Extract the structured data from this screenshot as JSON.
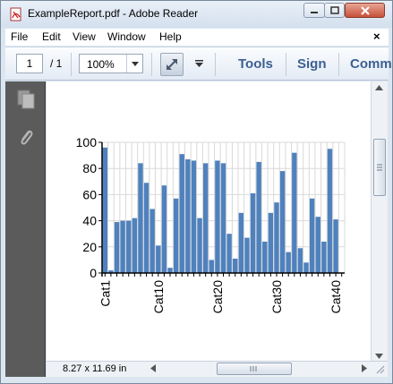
{
  "window": {
    "title": "ExampleReport.pdf - Adobe Reader"
  },
  "menu": {
    "items": [
      "File",
      "Edit",
      "View",
      "Window",
      "Help"
    ],
    "close_label": "×"
  },
  "toolbar": {
    "page_current": "1",
    "page_total": "/ 1",
    "zoom": "100%",
    "tools_label": "Tools",
    "sign_label": "Sign",
    "comment_label": "Comm"
  },
  "status": {
    "page_size": "8.27 x 11.69 in"
  },
  "colors": {
    "bar": "#4f81bd",
    "accent_link": "#3c5f91",
    "nav_pane": "#5b5b5b"
  },
  "icons": {
    "title": "pdf-file-icon",
    "nav_pages": "pages-icon",
    "nav_attach": "paperclip-icon",
    "expand": "expand-arrows-icon"
  },
  "chart_data": {
    "type": "bar",
    "categories": [
      "Cat1",
      "Cat2",
      "Cat3",
      "Cat4",
      "Cat5",
      "Cat6",
      "Cat7",
      "Cat8",
      "Cat9",
      "Cat10",
      "Cat11",
      "Cat12",
      "Cat13",
      "Cat14",
      "Cat15",
      "Cat16",
      "Cat17",
      "Cat18",
      "Cat19",
      "Cat20",
      "Cat21",
      "Cat22",
      "Cat23",
      "Cat24",
      "Cat25",
      "Cat26",
      "Cat27",
      "Cat28",
      "Cat29",
      "Cat30",
      "Cat31",
      "Cat32",
      "Cat33",
      "Cat34",
      "Cat35",
      "Cat36",
      "Cat37",
      "Cat38",
      "Cat39",
      "Cat40",
      "Cat41"
    ],
    "tick_labels": [
      "Cat1",
      "Cat10",
      "Cat20",
      "Cat30",
      "Cat40"
    ],
    "values": [
      96,
      2,
      39,
      40,
      40,
      42,
      84,
      69,
      49,
      21,
      67,
      4,
      57,
      91,
      87,
      86,
      42,
      84,
      10,
      86,
      84,
      30,
      11,
      46,
      27,
      61,
      85,
      24,
      46,
      54,
      78,
      16,
      92,
      19,
      8,
      57,
      43,
      24,
      95,
      41,
      0
    ],
    "yticks": [
      0,
      20,
      40,
      60,
      80,
      100
    ],
    "ylim": [
      0,
      100
    ],
    "grid": true,
    "title": "",
    "xlabel": "",
    "ylabel": ""
  }
}
